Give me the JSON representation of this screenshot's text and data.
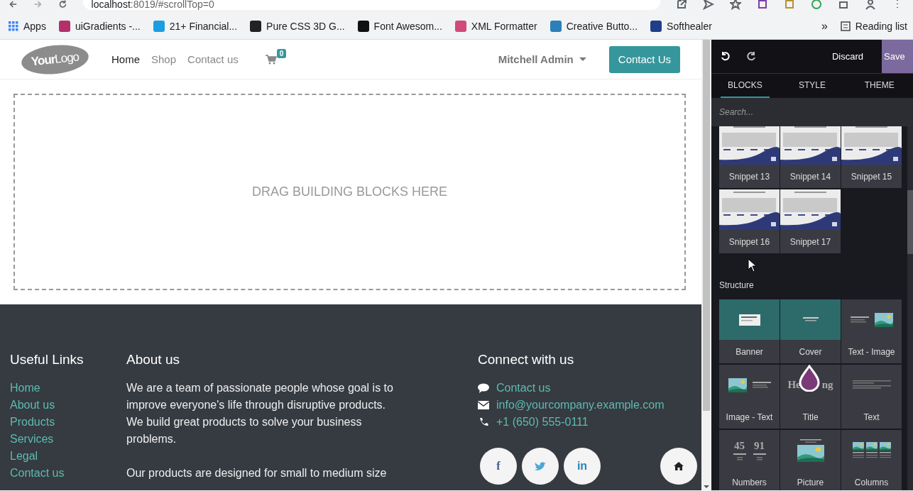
{
  "browser": {
    "url_host": "localhost",
    "url_path": ":8019/#scrollTop=0",
    "bookmarks": [
      {
        "label": "Apps",
        "color": "#4285f4"
      },
      {
        "label": "uiGradients -...",
        "color": "#b3306b"
      },
      {
        "label": "21+ Financial...",
        "color": "#1a9ee0"
      },
      {
        "label": "Pure CSS 3D G...",
        "color": "#222222"
      },
      {
        "label": "Font Awesom...",
        "color": "#111111"
      },
      {
        "label": "XML Formatter",
        "color": "#d04a7a"
      },
      {
        "label": "Creative Butto...",
        "color": "#2d7fb8"
      },
      {
        "label": "Softhealer",
        "color": "#1f3e8a"
      }
    ],
    "more": "»",
    "reading_list": "Reading list"
  },
  "header": {
    "logo_bold": "Your",
    "logo_text": "Logo",
    "nav": [
      {
        "label": "Home",
        "selected": true
      },
      {
        "label": "Shop",
        "selected": false
      },
      {
        "label": "Contact us",
        "selected": false
      }
    ],
    "cart_count": "0",
    "user": "Mitchell Admin",
    "cta": "Contact Us"
  },
  "dropzone": "DRAG BUILDING BLOCKS HERE",
  "footer": {
    "links_title": "Useful Links",
    "links": [
      "Home",
      "About us",
      "Products",
      "Services",
      "Legal",
      "Contact us"
    ],
    "about_title": "About us",
    "about": [
      "We are a team of passionate people whose goal is to improve everyone's life through disruptive products. We build great products to solve your business problems.",
      "Our products are designed for small to medium size"
    ],
    "connect_title": "Connect with us",
    "contacts": [
      {
        "kind": "chat",
        "label": "Contact us"
      },
      {
        "kind": "mail",
        "label": "info@yourcompany.example.com"
      },
      {
        "kind": "phone",
        "label": "+1 (650) 555-0111"
      }
    ],
    "social": [
      {
        "kind": "facebook",
        "glyph": "f"
      },
      {
        "kind": "twitter"
      },
      {
        "kind": "linkedin",
        "glyph": "in"
      },
      {
        "kind": "home"
      }
    ]
  },
  "editor": {
    "discard": "Discard",
    "save": "Save",
    "tabs": [
      {
        "label": "BLOCKS",
        "selected": true
      },
      {
        "label": "STYLE",
        "selected": false
      },
      {
        "label": "THEME",
        "selected": false
      }
    ],
    "search": {
      "placeholder": "Search..."
    },
    "snippets": [
      {
        "label": "Snippet 13"
      },
      {
        "label": "Snippet 14"
      },
      {
        "label": "Snippet 15"
      },
      {
        "label": "Snippet 16"
      },
      {
        "label": "Snippet 17"
      }
    ],
    "structure_title": "Structure",
    "structure": [
      {
        "kind": "banner",
        "label": "Banner"
      },
      {
        "kind": "cover",
        "label": "Cover"
      },
      {
        "kind": "text-image",
        "label": "Text - Image"
      },
      {
        "kind": "image-text",
        "label": "Image - Text"
      },
      {
        "kind": "title",
        "label": "Title",
        "thumb_texts": [
          "He",
          "ng"
        ]
      },
      {
        "kind": "text",
        "label": "Text"
      },
      {
        "kind": "numbers",
        "label": "Numbers",
        "thumb_texts": [
          "45",
          "91"
        ]
      },
      {
        "kind": "picture",
        "label": "Picture"
      },
      {
        "kind": "columns",
        "label": "Columns"
      }
    ]
  }
}
